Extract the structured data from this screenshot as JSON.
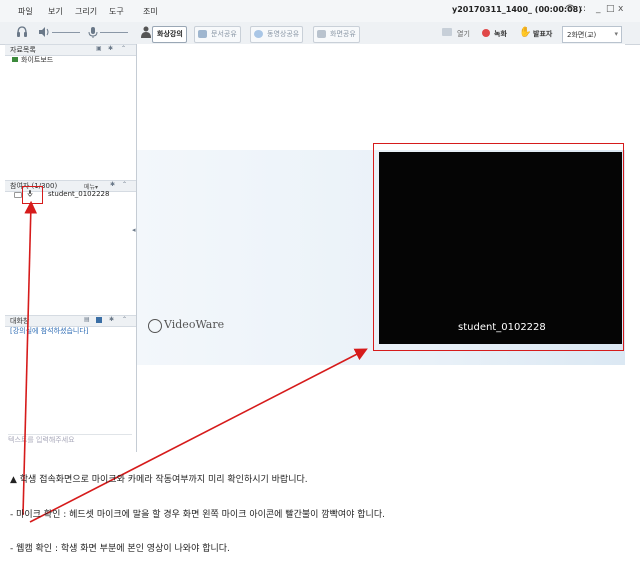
{
  "menu": [
    "파일",
    "보기",
    "그리기",
    "도구",
    "조미"
  ],
  "window_title": "y20170311_1400_ (00:00:08)",
  "window_controls": [
    "?",
    "::",
    "_",
    "□",
    "x"
  ],
  "tabs": [
    {
      "label": "화상강의",
      "active": true
    },
    {
      "label": "문서공유",
      "active": false
    },
    {
      "label": "동영상공유",
      "active": false
    },
    {
      "label": "화면공유",
      "active": false
    }
  ],
  "toolbar_right": {
    "open_label": "열기",
    "record_label": "녹화",
    "presenter_label": "발표자",
    "screen_select": "2화면(교)"
  },
  "resource_panel": {
    "title": "자료목록",
    "items": [
      "화이트보드"
    ]
  },
  "participant_panel": {
    "title": "참여자 (1/300)",
    "menu_label": "메뉴▾",
    "participants": [
      {
        "name": "student_0102228"
      }
    ]
  },
  "chat_panel": {
    "title": "대화창",
    "messages": [
      "[강의실에 참석하셨습니다]"
    ],
    "input_placeholder": "텍스트를 입력해주세요"
  },
  "stage": {
    "logo_text": "VideoWare",
    "video_label": "student_0102228"
  },
  "colors": {
    "highlight": "#d61b1b",
    "video_bg": "#050505",
    "accent": "#2f6db5"
  },
  "captions": [
    "▲ 학생 접속화면으로 마이크와 카메라 작동여부까지 미리 확인하시기 바랍니다.",
    "- 마이크 확인 : 헤드셋 마이크에 말을 할 경우 화면 왼쪽 마이크 아이콘에 빨간불이 깜빡여야 합니다.",
    "- 웹캠 확인 : 학생 화면 부분에 본인 영상이 나와야 합니다."
  ]
}
